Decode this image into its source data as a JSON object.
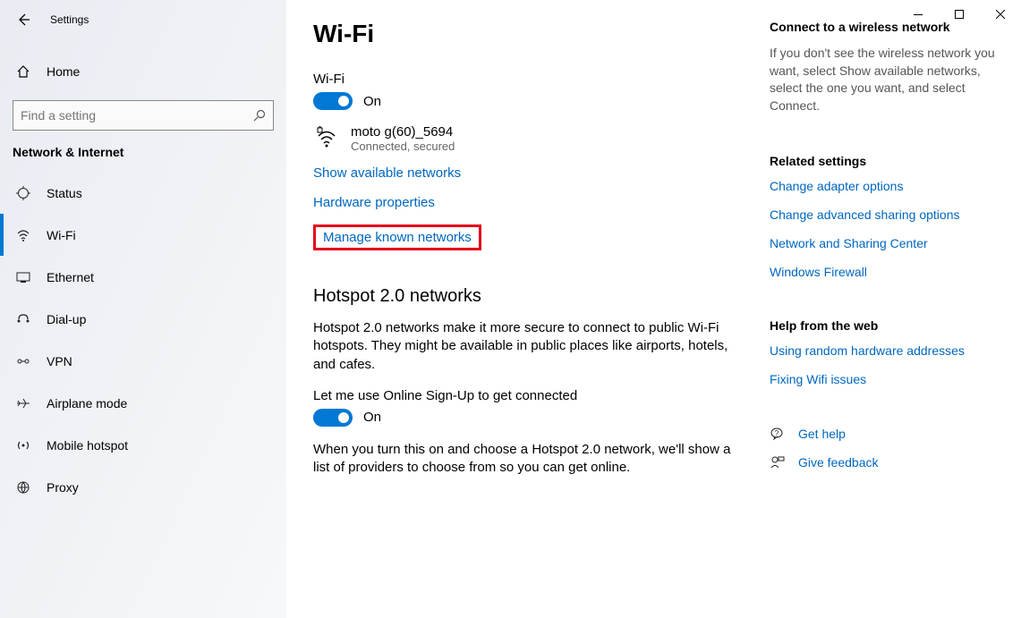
{
  "app_title": "Settings",
  "home_label": "Home",
  "search_placeholder": "Find a setting",
  "section_title": "Network & Internet",
  "nav": [
    {
      "label": "Status"
    },
    {
      "label": "Wi-Fi"
    },
    {
      "label": "Ethernet"
    },
    {
      "label": "Dial-up"
    },
    {
      "label": "VPN"
    },
    {
      "label": "Airplane mode"
    },
    {
      "label": "Mobile hotspot"
    },
    {
      "label": "Proxy"
    }
  ],
  "page": {
    "title": "Wi-Fi",
    "wifi_label": "Wi-Fi",
    "wifi_state": "On",
    "network_name": "moto g(60)_5694",
    "network_status": "Connected, secured",
    "link_show_networks": "Show available networks",
    "link_hw_props": "Hardware properties",
    "link_manage_known": "Manage known networks",
    "hotspot_title": "Hotspot 2.0 networks",
    "hotspot_desc": "Hotspot 2.0 networks make it more secure to connect to public Wi-Fi hotspots. They might be available in public places like airports, hotels, and cafes.",
    "signup_label": "Let me use Online Sign-Up to get connected",
    "signup_state": "On",
    "signup_desc": "When you turn this on and choose a Hotspot 2.0 network, we'll show a list of providers to choose from so you can get online."
  },
  "right": {
    "connect_title": "Connect to a wireless network",
    "connect_body": "If you don't see the wireless network you want, select Show available networks, select the one you want, and select Connect.",
    "related_title": "Related settings",
    "link_adapter": "Change adapter options",
    "link_sharing": "Change advanced sharing options",
    "link_center": "Network and Sharing Center",
    "link_firewall": "Windows Firewall",
    "help_title": "Help from the web",
    "link_random_hw": "Using random hardware addresses",
    "link_fix_wifi": "Fixing Wifi issues",
    "get_help": "Get help",
    "give_feedback": "Give feedback"
  }
}
